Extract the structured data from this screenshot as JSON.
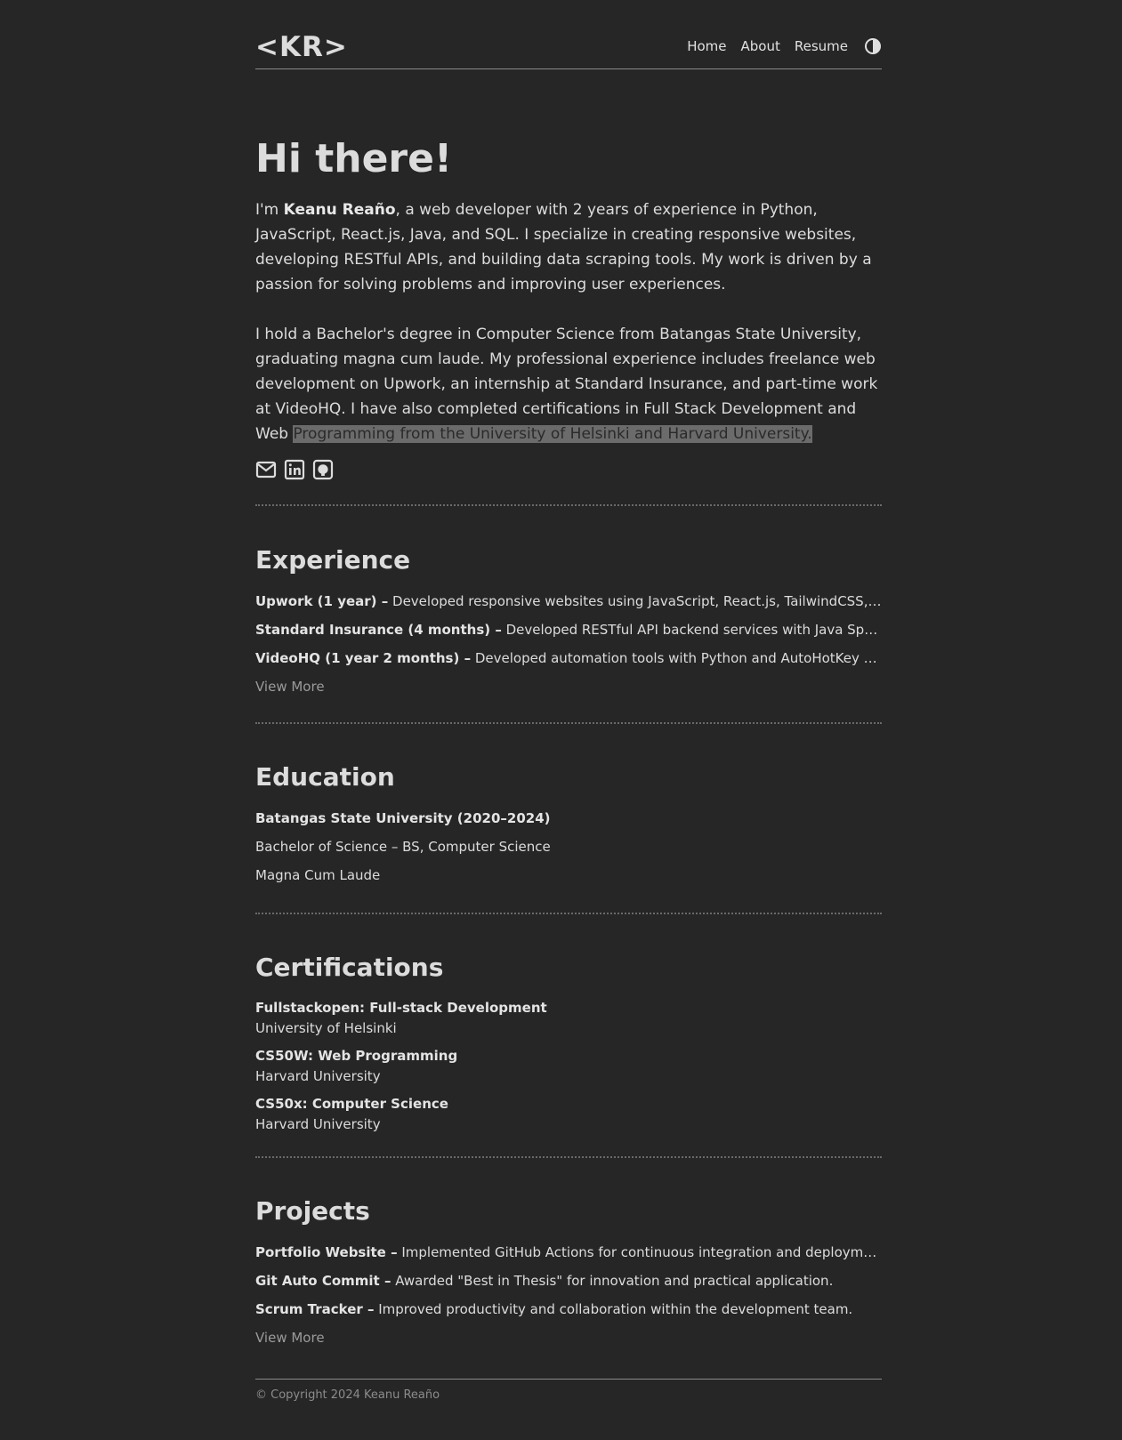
{
  "header": {
    "logo": "<KR>",
    "nav": [
      "Home",
      "About",
      "Resume"
    ],
    "theme_icon": "contrast-icon"
  },
  "intro": {
    "title": "Hi there!",
    "p1_prefix": "I'm ",
    "name": "Keanu Reaño",
    "p1_rest": ", a web developer with 2 years of experience in Python, JavaScript, React.js, Java, and SQL. I specialize in creating responsive websites, developing RESTful APIs, and building data scraping tools. My work is driven by a passion for solving problems and improving user experiences.",
    "p2_main": "I hold a Bachelor's degree in Computer Science from Batangas State University, graduating magna cum laude. My professional experience includes freelance web development on Upwork, an internship at Standard Insurance, and part-time work at VideoHQ. I have also completed certifications in Full Stack Development and Web ",
    "p2_highlight": "Programming from the University of Helsinki and Harvard University.",
    "social": [
      "mail-icon",
      "linkedin-icon",
      "github-icon"
    ]
  },
  "experience": {
    "title": "Experience",
    "items": [
      {
        "label": "Upwork (1 year) –",
        "text": " Developed responsive websites using JavaScript, React.js, TailwindCSS, Django, Node.js and more."
      },
      {
        "label": "Standard Insurance (4 months) –",
        "text": " Developed RESTful API backend services with Java Spring Boot and more."
      },
      {
        "label": "VideoHQ (1 year 2 months) –",
        "text": " Developed automation tools with Python and AutoHotKey to speed up workflows."
      }
    ],
    "view_more": "View More"
  },
  "education": {
    "title": "Education",
    "school": "Batangas State University (2020–2024)",
    "degree": "Bachelor of Science – BS, Computer Science",
    "honor": "Magna Cum Laude"
  },
  "certifications": {
    "title": "Certifications",
    "items": [
      {
        "name": "Fullstackopen: Full-stack Development",
        "org": "University of Helsinki"
      },
      {
        "name": "CS50W: Web Programming",
        "org": "Harvard University"
      },
      {
        "name": "CS50x: Computer Science",
        "org": "Harvard University"
      }
    ]
  },
  "projects": {
    "title": "Projects",
    "items": [
      {
        "label": "Portfolio Website –",
        "text": " Implemented GitHub Actions for continuous integration and deployment, ensuring reliable releases."
      },
      {
        "label": "Git Auto Commit –",
        "text": " Awarded \"Best in Thesis\" for innovation and practical application."
      },
      {
        "label": "Scrum Tracker –",
        "text": " Improved productivity and collaboration within the development team."
      }
    ],
    "view_more": "View More"
  },
  "footer": {
    "copyright": "© Copyright 2024 Keanu Reaño"
  }
}
